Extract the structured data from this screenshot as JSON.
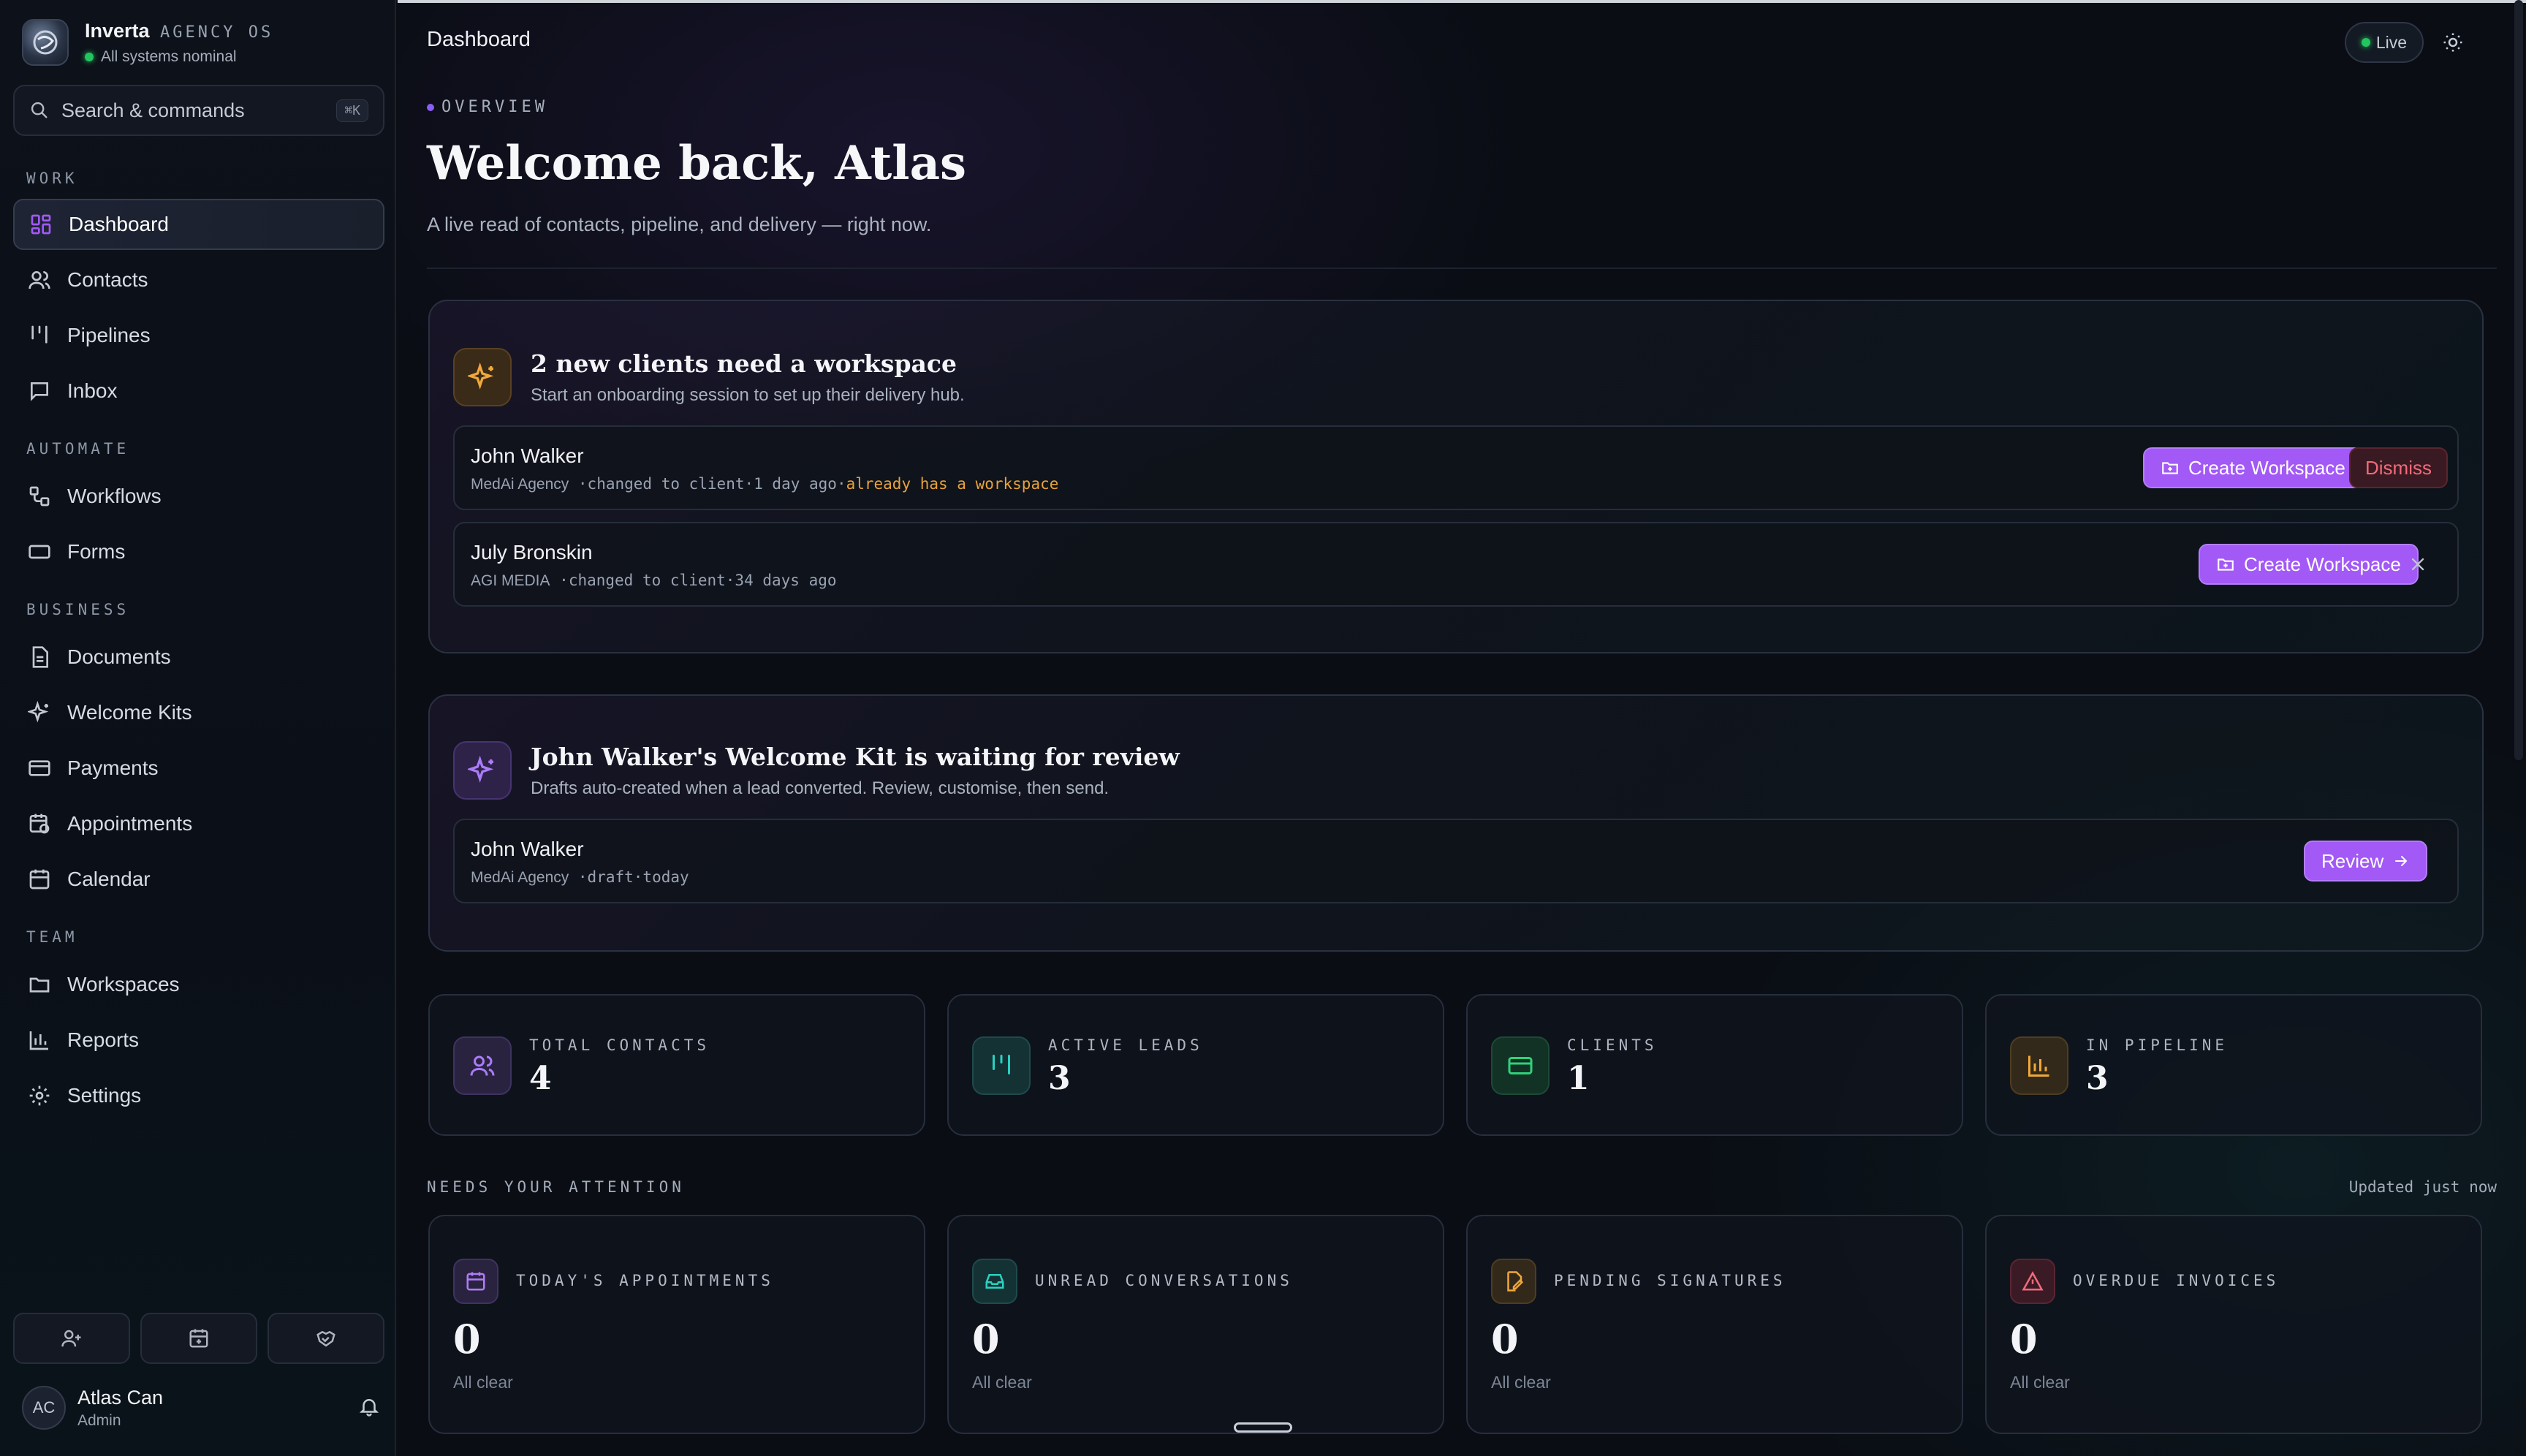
{
  "brand": {
    "name": "Inverta",
    "sub": "AGENCY OS",
    "status": "All systems nominal"
  },
  "search": {
    "label": "Search & commands",
    "shortcut": "⌘K"
  },
  "nav": {
    "sections": {
      "work": "WORK",
      "automate": "AUTOMATE",
      "business": "BUSINESS",
      "team": "TEAM"
    },
    "items": [
      {
        "label": "Dashboard",
        "icon": "grid-icon",
        "active": true
      },
      {
        "label": "Contacts",
        "icon": "users-icon"
      },
      {
        "label": "Pipelines",
        "icon": "columns-icon"
      },
      {
        "label": "Inbox",
        "icon": "message-icon"
      },
      {
        "label": "Workflows",
        "icon": "workflow-icon"
      },
      {
        "label": "Forms",
        "icon": "form-icon"
      },
      {
        "label": "Documents",
        "icon": "document-icon"
      },
      {
        "label": "Welcome Kits",
        "icon": "sparkles-icon"
      },
      {
        "label": "Payments",
        "icon": "credit-card-icon"
      },
      {
        "label": "Appointments",
        "icon": "calendar-clock-icon"
      },
      {
        "label": "Calendar",
        "icon": "calendar-icon"
      },
      {
        "label": "Workspaces",
        "icon": "folder-icon"
      },
      {
        "label": "Reports",
        "icon": "bar-chart-icon"
      },
      {
        "label": "Settings",
        "icon": "gear-icon"
      }
    ]
  },
  "user": {
    "initials": "AC",
    "name": "Atlas Can",
    "role": "Admin"
  },
  "topbar": {
    "title": "Dashboard",
    "live": "Live"
  },
  "hero": {
    "eyebrow": "OVERVIEW",
    "title": "Welcome back, Atlas",
    "lede": "A live read of contacts, pipeline, and delivery — right now."
  },
  "workspace_card": {
    "title": "2 new clients need a workspace",
    "subtitle": "Start an onboarding session to set up their delivery hub.",
    "rows": [
      {
        "name": "John Walker",
        "company": "MedAi Agency",
        "change": "changed to client",
        "when": "1 day ago",
        "warning": "already has a workspace",
        "action": "Create Workspace",
        "dismiss": "Dismiss"
      },
      {
        "name": "July Bronskin",
        "company": "AGI MEDIA",
        "change": "changed to client",
        "when": "34 days ago",
        "action": "Create Workspace"
      }
    ]
  },
  "kit_card": {
    "title": "John Walker's Welcome Kit is waiting for review",
    "subtitle": "Drafts auto-created when a lead converted. Review, customise, then send.",
    "row": {
      "name": "John Walker",
      "company": "MedAi Agency",
      "state": "draft",
      "when": "today",
      "action": "Review"
    }
  },
  "stats": [
    {
      "label": "TOTAL CONTACTS",
      "value": "4",
      "icon": "users-icon",
      "color": "#8b5cf6"
    },
    {
      "label": "ACTIVE LEADS",
      "value": "3",
      "icon": "columns-icon",
      "color": "#22c3b5"
    },
    {
      "label": "CLIENTS",
      "value": "1",
      "icon": "credit-card-icon",
      "color": "#22c55e"
    },
    {
      "label": "IN PIPELINE",
      "value": "3",
      "icon": "bar-chart-icon",
      "color": "#e8a23a"
    }
  ],
  "attention": {
    "label": "NEEDS YOUR ATTENTION",
    "updated": "Updated just now",
    "cards": [
      {
        "label": "TODAY'S APPOINTMENTS",
        "value": "0",
        "note": "All clear",
        "icon": "calendar-icon",
        "color": "#a259f5"
      },
      {
        "label": "UNREAD CONVERSATIONS",
        "value": "0",
        "note": "All clear",
        "icon": "inbox-icon",
        "color": "#22c3b5"
      },
      {
        "label": "PENDING SIGNATURES",
        "value": "0",
        "note": "All clear",
        "icon": "signature-icon",
        "color": "#e8a23a"
      },
      {
        "label": "OVERDUE INVOICES",
        "value": "0",
        "note": "All clear",
        "icon": "alert-triangle-icon",
        "color": "#f36a7a"
      }
    ]
  },
  "colors": {
    "accent": "#a259f5",
    "success": "#22c55e",
    "warning": "#e8a23a",
    "danger": "#f36a7a"
  }
}
